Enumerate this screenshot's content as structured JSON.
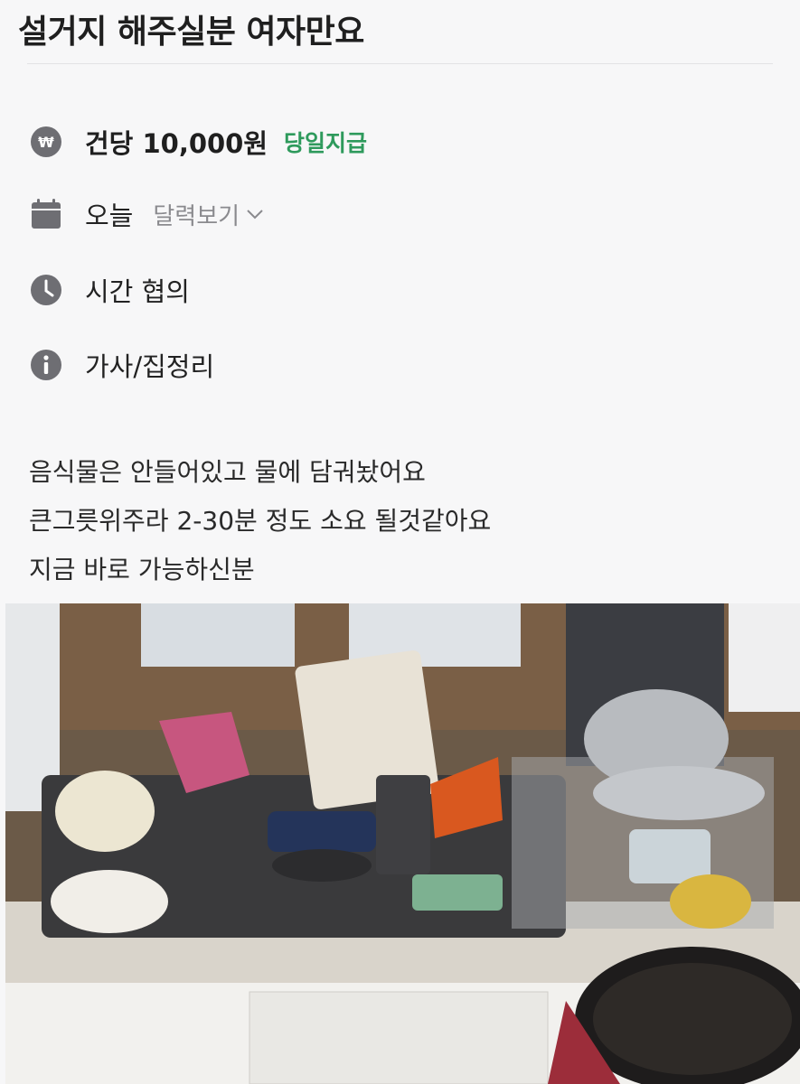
{
  "post": {
    "title": "설거지 해주실분 여자만요",
    "pay": {
      "amount_text": "건당 10,000원",
      "badge": "당일지급",
      "icon": "won-icon"
    },
    "date": {
      "text": "오늘",
      "link": "달력보기",
      "icon": "calendar-icon"
    },
    "time": {
      "text": "시간 협의",
      "icon": "clock-icon"
    },
    "category": {
      "text": "가사/집정리",
      "icon": "info-icon"
    },
    "description": [
      "음식물은 안들어있고 물에 담궈놨어요",
      "큰그릇위주라 2-30분 정도 소요 될것같아요",
      "지금 바로 가능하신분"
    ]
  },
  "colors": {
    "accent_green": "#2e9a5c",
    "icon_gray": "#6e6e73",
    "muted": "#8a8a8e"
  }
}
